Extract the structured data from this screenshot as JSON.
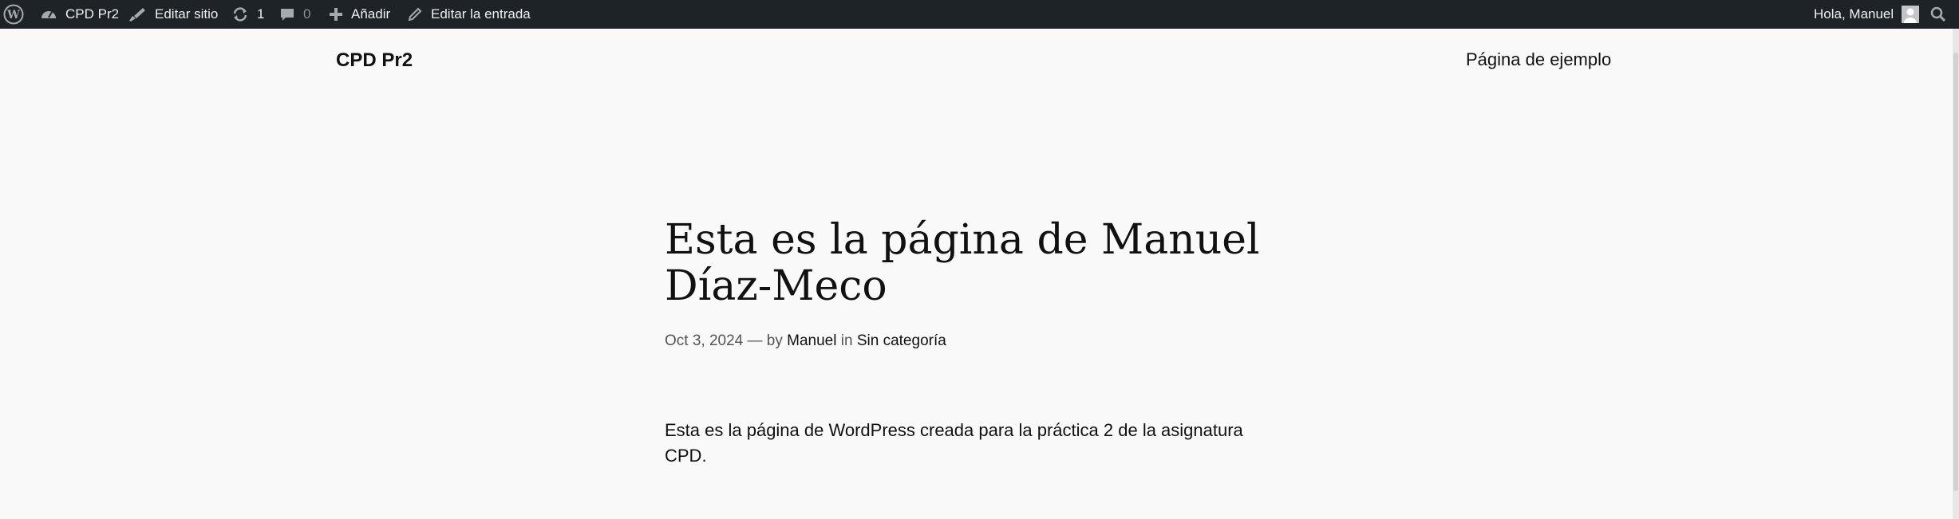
{
  "admin_bar": {
    "site_name": "CPD Pr2",
    "edit_site": "Editar sitio",
    "updates_count": "1",
    "comments_count": "0",
    "add_new": "Añadir",
    "edit_post": "Editar la entrada",
    "greeting": "Hola, Manuel",
    "icons": [
      "wordpress-logo-icon",
      "dashboard-icon",
      "brush-icon",
      "updates-icon",
      "comment-icon",
      "plus-icon",
      "pencil-icon",
      "avatar-icon",
      "search-icon"
    ]
  },
  "header": {
    "site_title": "CPD Pr2",
    "nav_items": [
      "Página de ejemplo"
    ]
  },
  "post": {
    "title": "Esta es la página de Manuel Díaz-Meco",
    "date": "Oct 3, 2024",
    "separator": "—",
    "by": "by",
    "author": "Manuel",
    "in": "in",
    "category": "Sin categoría",
    "content": "Esta es la página de WordPress creada para la práctica 2 de la asignatura CPD."
  },
  "colors": {
    "admin_bar_bg": "#1d2327",
    "page_bg": "#f9f9f9",
    "text": "#111111"
  }
}
